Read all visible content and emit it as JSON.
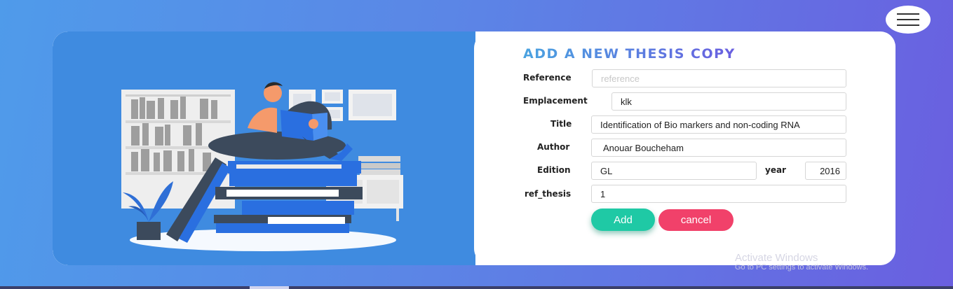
{
  "form": {
    "title": "ADD A NEW THESIS COPY",
    "fields": {
      "reference": {
        "label": "Reference",
        "value": "",
        "placeholder": "reference"
      },
      "emplacement": {
        "label": "Emplacement",
        "value": "klk"
      },
      "title": {
        "label": "Title",
        "value": "Identification of Bio markers and non-coding RNA"
      },
      "author": {
        "label": "Author",
        "value": "Anouar Boucheham"
      },
      "edition": {
        "label": "Edition",
        "value": "GL"
      },
      "year": {
        "label": "year",
        "value": "2016"
      },
      "ref_thesis": {
        "label": "ref_thesis",
        "value": "1"
      }
    },
    "buttons": {
      "add": "Add",
      "cancel": "cancel"
    }
  },
  "menu": {
    "icon": "hamburger-menu-icon"
  },
  "illustration": {
    "subject": "person-reading-on-book-stack"
  },
  "watermark": {
    "line1": "Activate Windows",
    "line2": "Go to PC settings to activate Windows."
  },
  "colors": {
    "panel_blue": "#3f8be0",
    "add_button": "#1fc9a5",
    "cancel_button": "#f1416a",
    "title_gradient_start": "#4aa3e0",
    "title_gradient_end": "#6a5fe0"
  }
}
